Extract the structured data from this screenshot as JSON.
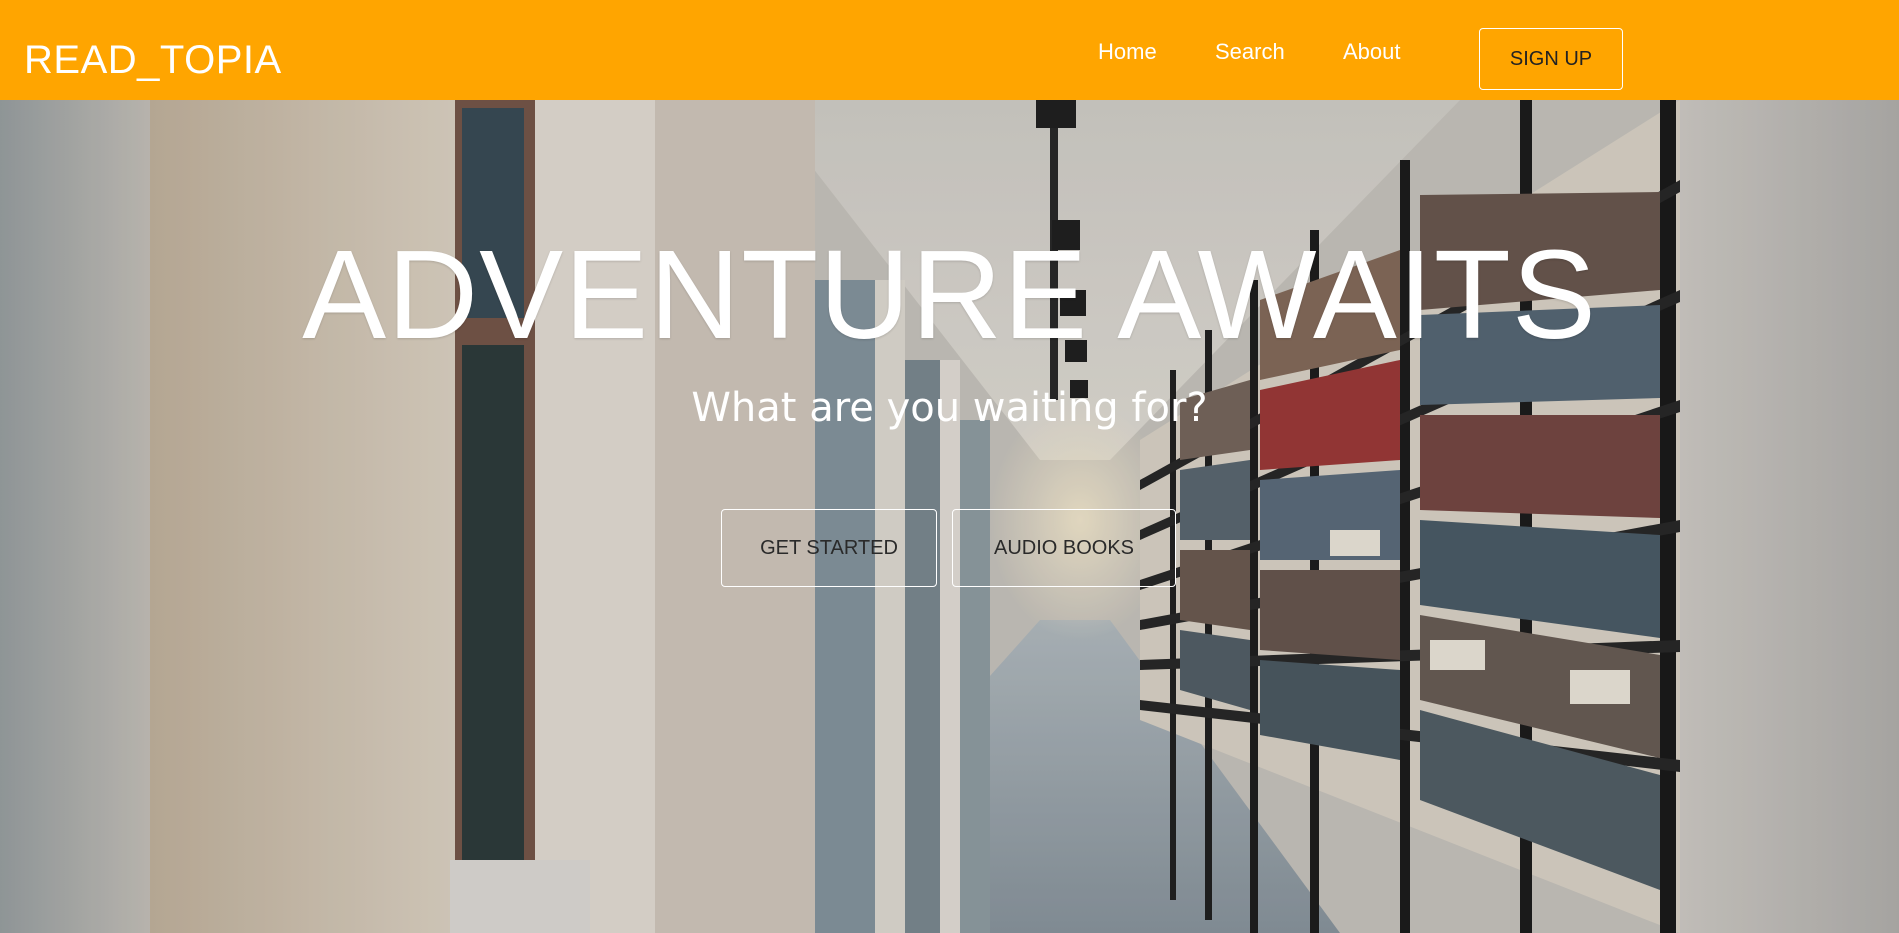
{
  "brand": {
    "name": "READ_TOPIA"
  },
  "nav": {
    "home": "Home",
    "search": "Search",
    "about": "About",
    "signup": "SIGN UP"
  },
  "hero": {
    "headline": "ADVENTURE AWAITS",
    "subheadline": "What are you waiting for?",
    "get_started": "GET STARTED",
    "audio_books": "AUDIO BOOKS"
  },
  "colors": {
    "navbar": "#ffa500",
    "text_light": "#ffffff"
  }
}
